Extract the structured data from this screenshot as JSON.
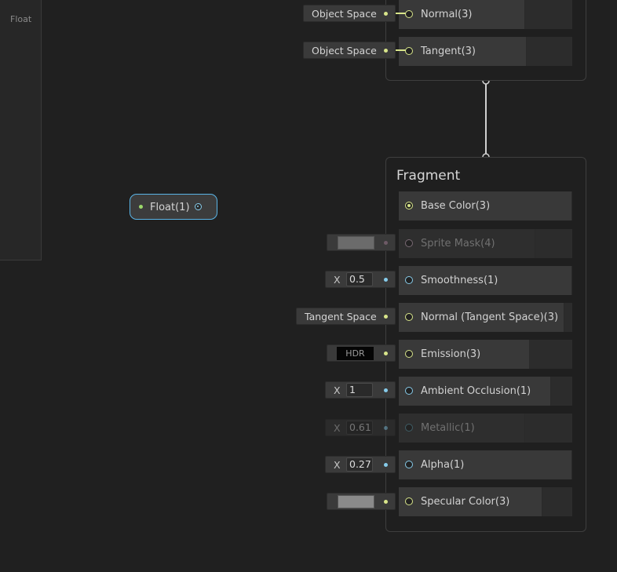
{
  "left_panel": {
    "label": "Float"
  },
  "colors": {
    "vector3": "#d8e58a",
    "vector1": "#86cbea",
    "vector4": "#f0b0e0",
    "selection": "#5ab4e6"
  },
  "vertex_block": {
    "slots": [
      {
        "label": "Normal(3)",
        "inline": "Object Space"
      },
      {
        "label": "Tangent(3)",
        "inline": "Object Space"
      }
    ]
  },
  "fragment_block": {
    "title": "Fragment",
    "slots": [
      {
        "label": "Base Color(3)",
        "port_type": "vector3",
        "connected": true
      },
      {
        "label": "Sprite Mask(4)",
        "port_type": "vector4",
        "disabled": true,
        "inline_kind": "color",
        "swatch": "#6b6b6b"
      },
      {
        "label": "Smoothness(1)",
        "port_type": "vector1",
        "inline_kind": "float",
        "axis": "X",
        "value": "0.5"
      },
      {
        "label": "Normal (Tangent Space)(3)",
        "port_type": "vector3",
        "inline_kind": "text",
        "text": "Tangent Space"
      },
      {
        "label": "Emission(3)",
        "port_type": "vector3",
        "inline_kind": "hdr",
        "text": "HDR"
      },
      {
        "label": "Ambient Occlusion(1)",
        "port_type": "vector1",
        "inline_kind": "float",
        "axis": "X",
        "value": "1"
      },
      {
        "label": "Metallic(1)",
        "port_type": "vector1",
        "disabled": true,
        "inline_kind": "float",
        "axis": "X",
        "value": "0.61"
      },
      {
        "label": "Alpha(1)",
        "port_type": "vector1",
        "inline_kind": "float",
        "axis": "X",
        "value": "0.27"
      },
      {
        "label": "Specular Color(3)",
        "port_type": "vector3",
        "inline_kind": "color",
        "swatch": "#8a8a8a"
      }
    ]
  },
  "float_node": {
    "label": "Float(1)"
  }
}
